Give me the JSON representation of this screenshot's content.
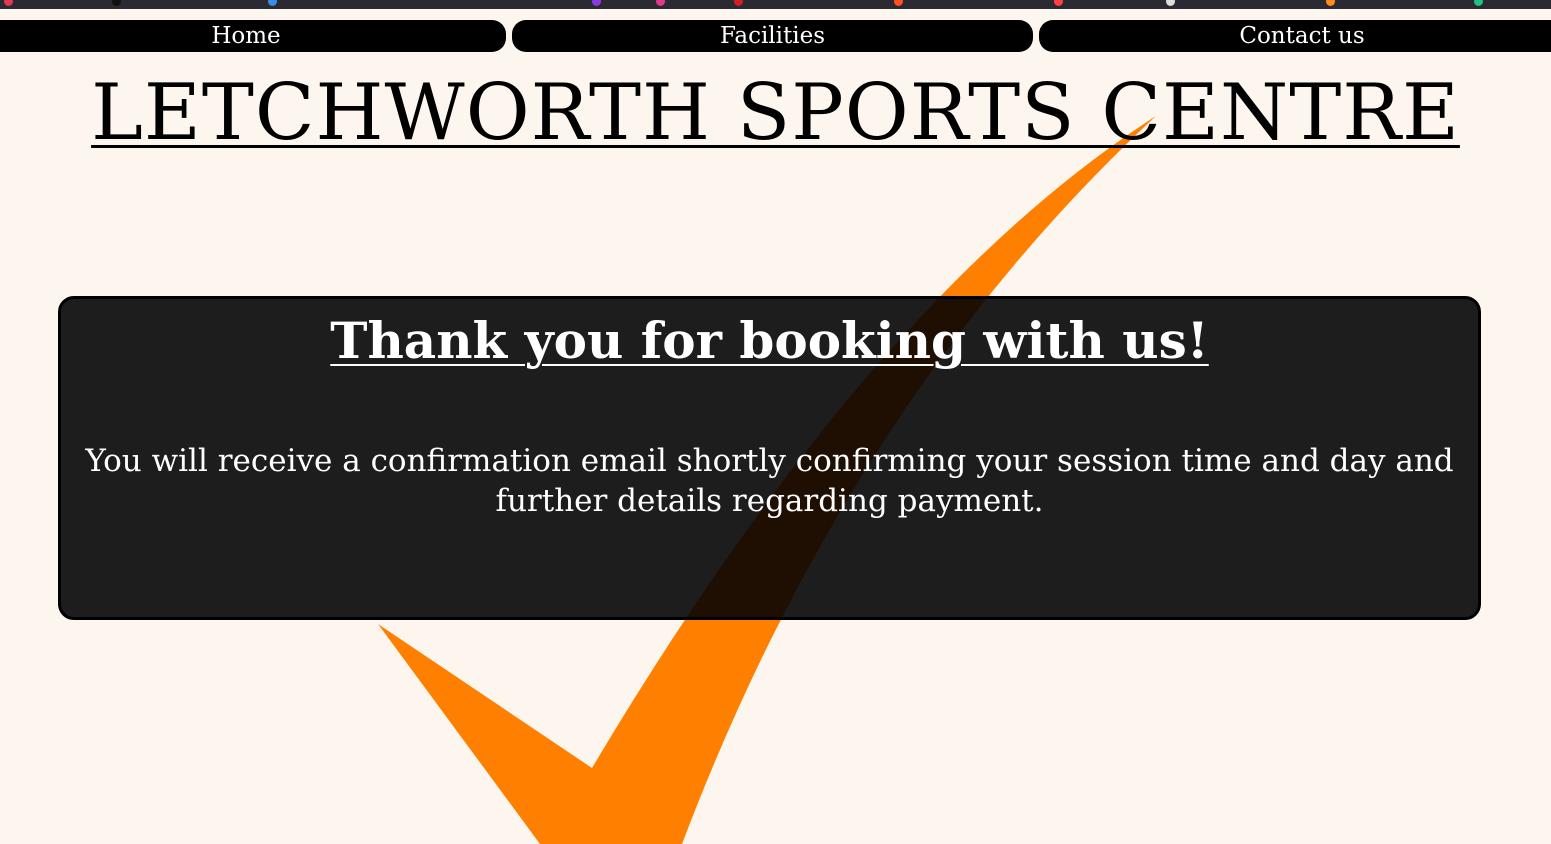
{
  "nav": {
    "items": [
      {
        "label": "Home"
      },
      {
        "label": "Facilities"
      },
      {
        "label": "Contact us"
      }
    ]
  },
  "header": {
    "title": "LETCHWORTH SPORTS CENTRE"
  },
  "confirmation": {
    "heading": "Thank you for booking with us!",
    "message": "You will receive a confirmation email shortly confirming your session time and day and further details regarding payment."
  },
  "colors": {
    "background": "#fdf6ee",
    "nav_background": "#000000",
    "accent_checkmark": "#ff8000",
    "panel_background": "#181818",
    "text_light": "#ffffff"
  },
  "icons": {
    "background_graphic": "checkmark-icon"
  }
}
